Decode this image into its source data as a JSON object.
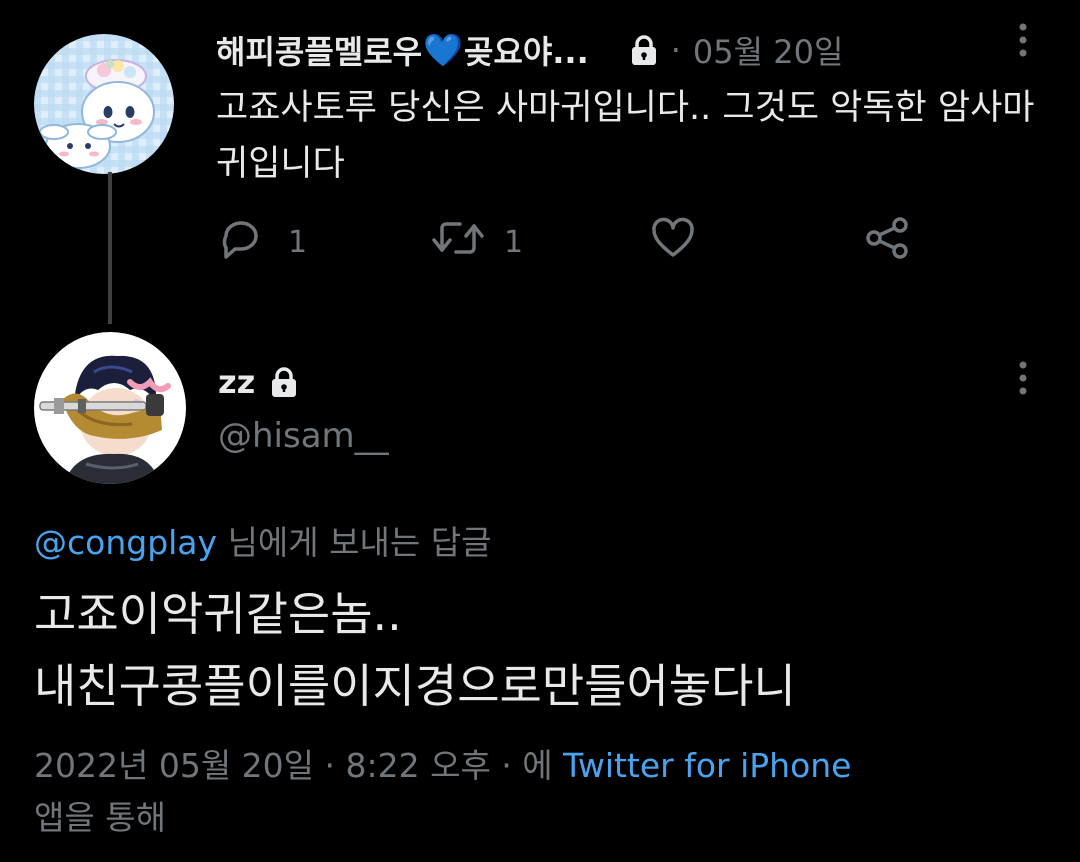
{
  "parent_tweet": {
    "display_name": "해피콩플멜로우",
    "name_emoji": "💙",
    "name_suffix": "곶요야...",
    "separator": "·",
    "date": "05월 20일",
    "text": "고죠사토루 당신은 사마귀입니다.. 그것도 악독한 암사마귀입니다",
    "reply_count": "1",
    "retweet_count": "1",
    "icons": [
      "lock-icon",
      "more-icon",
      "reply-icon",
      "retweet-icon",
      "like-icon",
      "share-icon"
    ]
  },
  "reply_tweet": {
    "display_name": "zz",
    "handle": "@hisam__",
    "replying_to_mention": "@congplay",
    "replying_to_suffix": " 님에게 보내는 답글",
    "text_line1": "고죠이악귀같은놈..",
    "text_line2": "내친구콩플이를이지경으로만들어놓다니",
    "meta_prefix": "2022년 05월 20일 · 8:22 오후 · 에 ",
    "meta_source": "Twitter for iPhone",
    "meta_suffix": "앱을 통해"
  },
  "colors": {
    "background": "#000000",
    "text_primary": "#e7e9ea",
    "text_secondary": "#71767b",
    "accent": "#4aa3ef",
    "thread_line": "#3e4144"
  }
}
